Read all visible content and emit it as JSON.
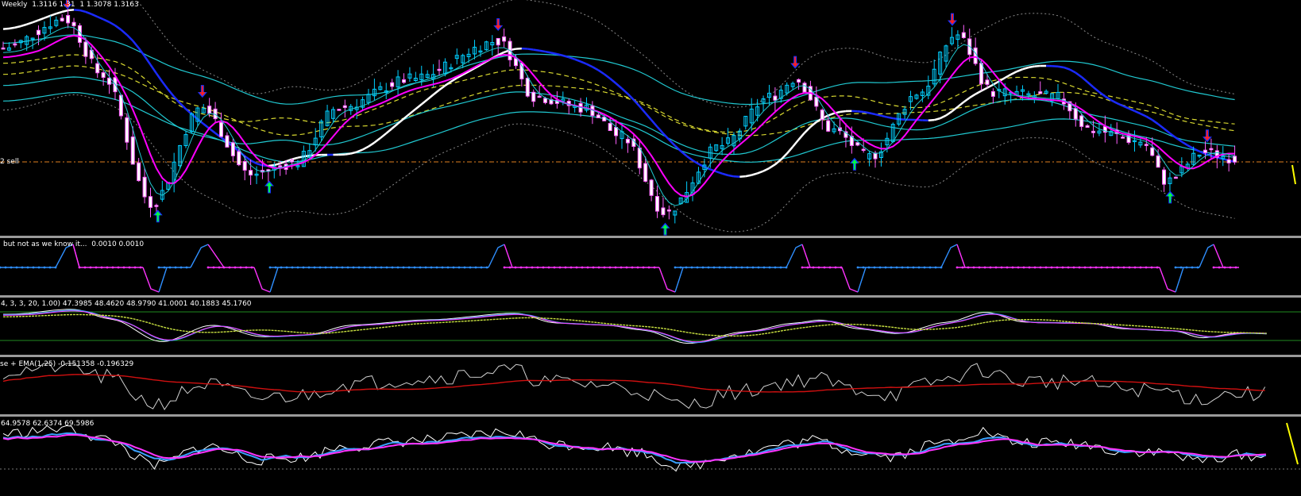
{
  "main_chart": {
    "header": "Weekly  1.3116 1.31  1 1.3078 1.3163",
    "level_label": "2 sell",
    "colors": {
      "bull_candle": "#00cfff",
      "bear_candle": "#ff60ff",
      "ma_fast": "#ff00ff",
      "ma_slow_blue": "#1b2bff",
      "ma_slow_white": "#ffffff",
      "band_cyan": "#20c8d0",
      "band_yellow": "#d8d830",
      "envelope": "#888888",
      "level_line": "#e08020",
      "up_arrow": "#00ff40",
      "down_arrow": "#ff2020"
    },
    "signals": {
      "up": [
        0.125,
        0.215,
        0.535,
        0.688,
        0.943
      ],
      "down": [
        0.052,
        0.161,
        0.4,
        0.64,
        0.767,
        0.973
      ]
    }
  },
  "panes": [
    {
      "name": "pane-oscillator-step",
      "label": "but not as we know it...  0.0010 0.0010"
    },
    {
      "name": "pane-stochastic",
      "label": "4, 3, 3, 20, 1.00) 47.3985 48.4620 48.9790 41.0001 40.1883 45.1760"
    },
    {
      "name": "pane-ema-smooth",
      "label": "se + EMA(1,25) -0.151358 -0.196329"
    },
    {
      "name": "pane-rsi",
      "label": "64.9578 62.6374 69.5986"
    }
  ]
}
